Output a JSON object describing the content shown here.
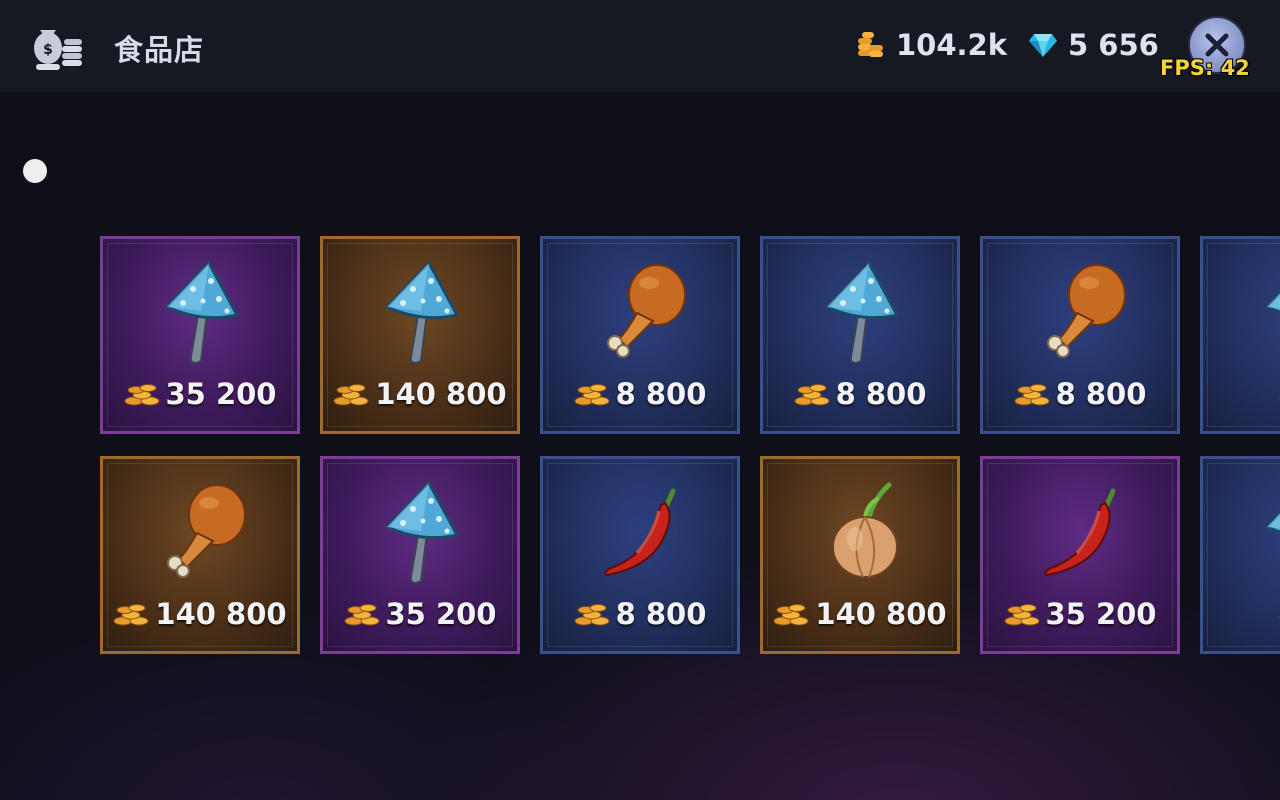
{
  "header": {
    "shop_icon": "coin-bag-icon",
    "title": "食品店",
    "gold": {
      "icon": "gold-coins-icon",
      "value": "104.2k"
    },
    "gems": {
      "icon": "diamond-icon",
      "value": "5 656"
    },
    "close_icon": "close-icon",
    "fps": "FPS: 42"
  },
  "colors": {
    "purple_rarity": "#7a3f95",
    "orange_rarity": "#9c6a2c",
    "blue_rarity": "#3b4f8a",
    "fps_text": "#f2d43a"
  },
  "items": [
    {
      "name": "mushroom",
      "rarity": "purple",
      "price": "35 200"
    },
    {
      "name": "mushroom",
      "rarity": "orange",
      "price": "140 800"
    },
    {
      "name": "drumstick",
      "rarity": "blue",
      "price": "8 800"
    },
    {
      "name": "mushroom",
      "rarity": "blue",
      "price": "8 800"
    },
    {
      "name": "drumstick",
      "rarity": "blue",
      "price": "8 800"
    },
    {
      "name": "mushroom",
      "rarity": "blue",
      "price": ""
    },
    {
      "name": "drumstick",
      "rarity": "orange",
      "price": "140 800"
    },
    {
      "name": "mushroom",
      "rarity": "purple",
      "price": "35 200"
    },
    {
      "name": "chili-pepper",
      "rarity": "blue",
      "price": "8 800"
    },
    {
      "name": "onion",
      "rarity": "orange",
      "price": "140 800"
    },
    {
      "name": "chili-pepper",
      "rarity": "purple",
      "price": "35 200"
    },
    {
      "name": "mushroom",
      "rarity": "blue",
      "price": ""
    }
  ]
}
